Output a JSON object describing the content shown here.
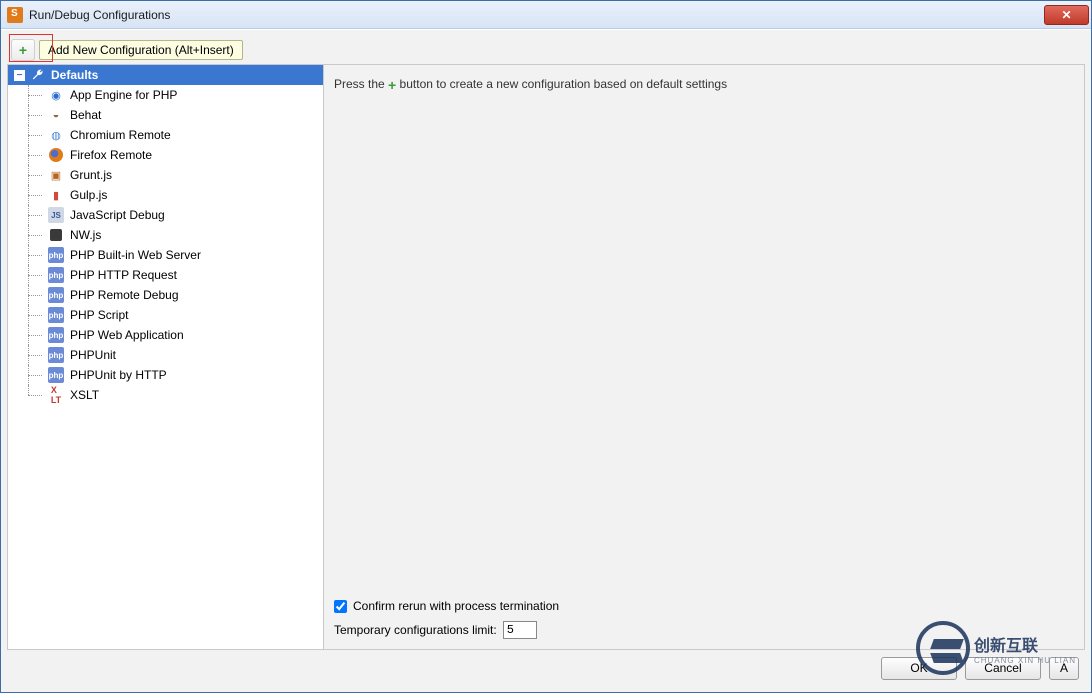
{
  "window": {
    "title": "Run/Debug Configurations"
  },
  "toolbar": {
    "tooltip": "Add New Configuration (Alt+Insert)"
  },
  "tree": {
    "root": "Defaults",
    "items": [
      {
        "label": "App Engine for PHP",
        "icon": "appengine"
      },
      {
        "label": "Behat",
        "icon": "behat"
      },
      {
        "label": "Chromium Remote",
        "icon": "chromium"
      },
      {
        "label": "Firefox Remote",
        "icon": "firefox"
      },
      {
        "label": "Grunt.js",
        "icon": "grunt"
      },
      {
        "label": "Gulp.js",
        "icon": "gulp"
      },
      {
        "label": "JavaScript Debug",
        "icon": "jsdebug"
      },
      {
        "label": "NW.js",
        "icon": "nw"
      },
      {
        "label": "PHP Built-in Web Server",
        "icon": "php"
      },
      {
        "label": "PHP HTTP Request",
        "icon": "php"
      },
      {
        "label": "PHP Remote Debug",
        "icon": "php"
      },
      {
        "label": "PHP Script",
        "icon": "php"
      },
      {
        "label": "PHP Web Application",
        "icon": "php"
      },
      {
        "label": "PHPUnit",
        "icon": "php"
      },
      {
        "label": "PHPUnit by HTTP",
        "icon": "php"
      },
      {
        "label": "XSLT",
        "icon": "xslt"
      }
    ]
  },
  "right": {
    "hint_pre": "Press the ",
    "hint_post": " button to create a new configuration based on default settings",
    "confirm_label": "Confirm rerun with process termination",
    "confirm_checked": true,
    "limit_label": "Temporary configurations limit:",
    "limit_value": "5"
  },
  "buttons": {
    "ok": "OK",
    "cancel": "Cancel",
    "apply": "A"
  },
  "watermark": {
    "text": "创新互联",
    "sub": "CHUANG XIN HU LIAN"
  }
}
